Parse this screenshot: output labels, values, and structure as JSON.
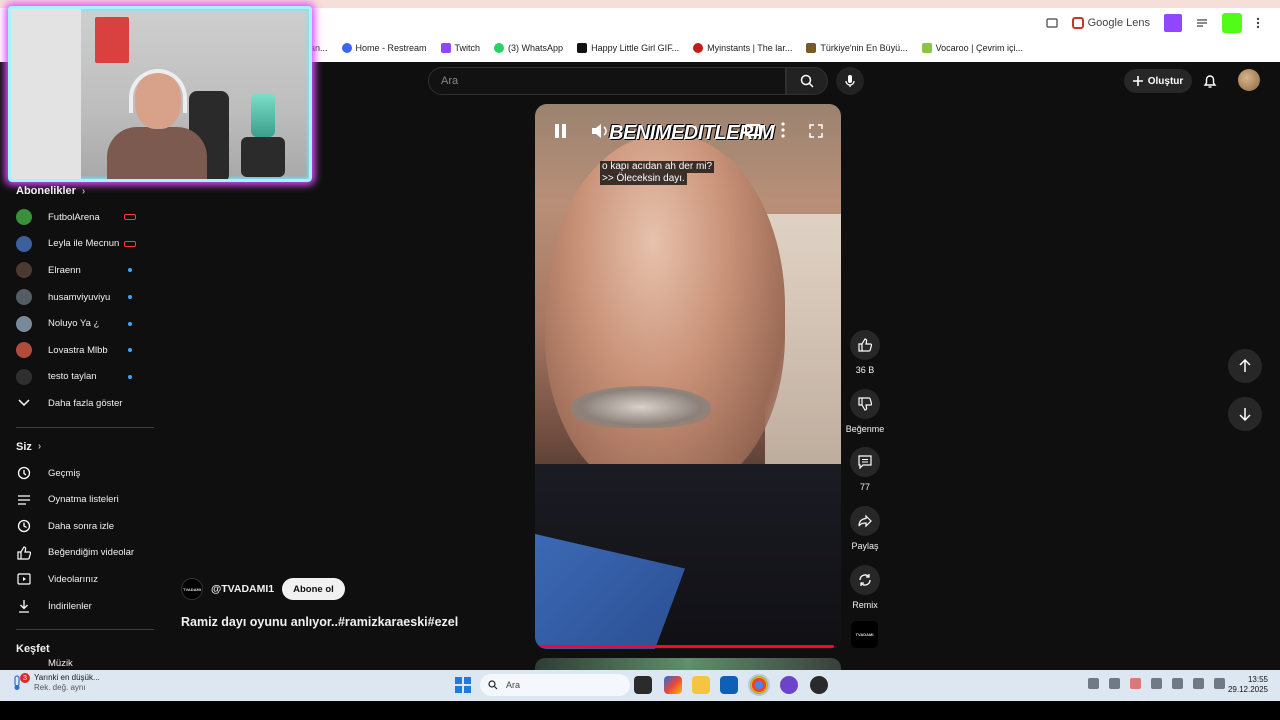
{
  "browser": {
    "address_right": {
      "google_label": "Google Lens"
    },
    "bookmarks": [
      {
        "label": "an...",
        "icon": "bookmark-icon",
        "color": "#888888"
      },
      {
        "label": "Home - Restream",
        "icon": "restream-icon",
        "color": "#3b66f5"
      },
      {
        "label": "Twitch",
        "icon": "twitch-icon",
        "color": "#9146ff"
      },
      {
        "label": "(3) WhatsApp",
        "icon": "whatsapp-icon",
        "color": "#25d366"
      },
      {
        "label": "Happy Little Girl GIF...",
        "icon": "gif-icon",
        "color": "#111111"
      },
      {
        "label": "Myinstants | The lar...",
        "icon": "myinstants-icon",
        "color": "#c41a1a"
      },
      {
        "label": "Türkiye'nin En Büyü...",
        "icon": "sahibinden-icon",
        "color": "#7a5a2a"
      },
      {
        "label": "Vocaroo | Çevrim içi...",
        "icon": "vocaroo-icon",
        "color": "#8cc63f"
      }
    ]
  },
  "header": {
    "search_placeholder": "Ara",
    "create_label": "Oluştur"
  },
  "sidebar": {
    "subscriptions_title": "Abonelikler",
    "subscriptions": [
      {
        "label": "FutbolArena",
        "status": "live",
        "avatar_color": "#3a8f3a"
      },
      {
        "label": "Leyla ile Mecnun",
        "status": "live",
        "avatar_color": "#3d5f9c"
      },
      {
        "label": "Elraenn",
        "status": "new",
        "avatar_color": "#4a3a33"
      },
      {
        "label": "husamviyuviyu",
        "status": "new",
        "avatar_color": "#555c66"
      },
      {
        "label": "Noluyo Ya ¿",
        "status": "new",
        "avatar_color": "#7a8a9a"
      },
      {
        "label": "Lovastra Mlbb",
        "status": "new",
        "avatar_color": "#b04c3c"
      },
      {
        "label": "testo taylan",
        "status": "new",
        "avatar_color": "#2f2f2f"
      }
    ],
    "show_more_label": "Daha fazla göster",
    "you_title": "Siz",
    "you_items": [
      {
        "label": "Geçmiş",
        "icon": "history-icon"
      },
      {
        "label": "Oynatma listeleri",
        "icon": "playlist-icon"
      },
      {
        "label": "Daha sonra izle",
        "icon": "watch-later-icon"
      },
      {
        "label": "Beğendiğim videolar",
        "icon": "like-icon"
      },
      {
        "label": "Videolarınız",
        "icon": "your-videos-icon"
      },
      {
        "label": "İndirilenler",
        "icon": "download-icon"
      }
    ],
    "explore_title": "Keşfet",
    "explore_partial": "Müzik"
  },
  "player": {
    "watermark": "BENIMEDITLERIM",
    "caption_line1": "o kapı acıdan ah der mi?",
    "caption_line2": ">> Öleceksin dayı.",
    "progress": 0.99
  },
  "actions": {
    "like_count": "36 B",
    "dislike_label": "Beğenme",
    "comment_count": "77",
    "share_label": "Paylaş",
    "remix_label": "Remix",
    "channel_mini_text": "TVADAMI"
  },
  "channel": {
    "handle": "@TVADAMI1",
    "avatar_text": "TVADAMI",
    "subscribe_label": "Abone ol"
  },
  "video": {
    "title": "Ramiz dayı oyunu anlıyor..#ramizkaraeski#ezel"
  },
  "taskbar": {
    "weather_badge": "3",
    "weather_line1": "Yarınki en düşük...",
    "weather_line2": "Rek. değ. aynı",
    "search_placeholder": "Ara",
    "time": "13:55",
    "date": "29.12.2025"
  },
  "colors": {
    "yt_bg": "#0f0f0f",
    "accent_red": "#ff0033",
    "webcam_glow": "#e04cff",
    "webcam_border": "#a6f4ff"
  }
}
